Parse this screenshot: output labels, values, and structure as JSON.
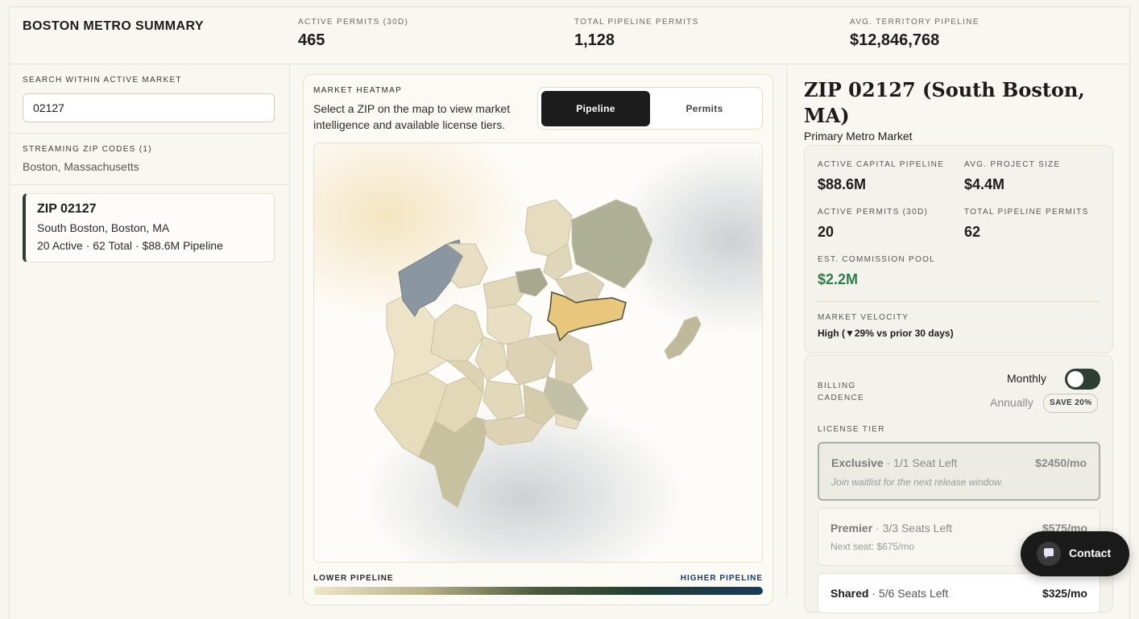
{
  "summary": {
    "title": "BOSTON METRO SUMMARY",
    "stats": [
      {
        "label": "ACTIVE PERMITS (30D)",
        "value": "465"
      },
      {
        "label": "TOTAL PIPELINE PERMITS",
        "value": "1,128"
      },
      {
        "label": "AVG. TERRITORY PIPELINE",
        "value": "$12,846,768"
      }
    ]
  },
  "sidebar": {
    "search_label": "SEARCH WITHIN ACTIVE MARKET",
    "search_value": "02127",
    "streaming_label": "STREAMING ZIP CODES (1)",
    "streaming_location": "Boston, Massachusetts",
    "results": [
      {
        "title": "ZIP 02127",
        "place": "South Boston, Boston, MA",
        "stats": "20 Active · 62 Total · $88.6M Pipeline"
      }
    ]
  },
  "heatmap": {
    "label": "MARKET HEATMAP",
    "description": "Select a ZIP on the map to view market intelligence and available license tiers.",
    "modes": [
      {
        "label": "Pipeline",
        "active": true
      },
      {
        "label": "Permits",
        "active": false
      }
    ],
    "legend_low": "LOWER PIPELINE",
    "legend_high": "HIGHER PIPELINE",
    "colors": {
      "selected": "#e8c77d",
      "dark": "#8a96a0",
      "medium": "#9ea08a",
      "light": "#e8dfc4"
    }
  },
  "detail": {
    "title": "ZIP 02127 (South Boston, MA)",
    "subtitle": "Primary Metro Market",
    "metrics": [
      {
        "label": "ACTIVE CAPITAL PIPELINE",
        "value": "$88.6M"
      },
      {
        "label": "AVG. PROJECT SIZE",
        "value": "$4.4M"
      },
      {
        "label": "ACTIVE PERMITS (30D)",
        "value": "20"
      },
      {
        "label": "TOTAL PIPELINE PERMITS",
        "value": "62"
      },
      {
        "label": "EST. COMMISSION POOL",
        "value": "$2.2M"
      }
    ],
    "velocity_label": "MARKET VELOCITY",
    "velocity_value": "High (▼29% vs prior 30 days)",
    "billing": {
      "label": "BILLING CADENCE",
      "monthly": "Monthly",
      "annually": "Annually",
      "save_badge": "SAVE 20%",
      "monthly_selected": true
    },
    "license_label": "LICENSE TIER",
    "tiers": [
      {
        "name": "Exclusive",
        "seats": " · 1/1 Seat Left",
        "price": "$2450/mo",
        "note": "Join waitlist for the next release window."
      },
      {
        "name": "Premier",
        "seats": " · 3/3 Seats Left",
        "price": "$575/mo",
        "note": "Next seat: $675/mo"
      },
      {
        "name": "Shared",
        "seats": " · 5/6 Seats Left",
        "price": "$325/mo",
        "note": ""
      }
    ],
    "accent_green": "#2e7d4a"
  },
  "contact": {
    "label": "Contact",
    "icon": "chat-bubble-icon"
  }
}
